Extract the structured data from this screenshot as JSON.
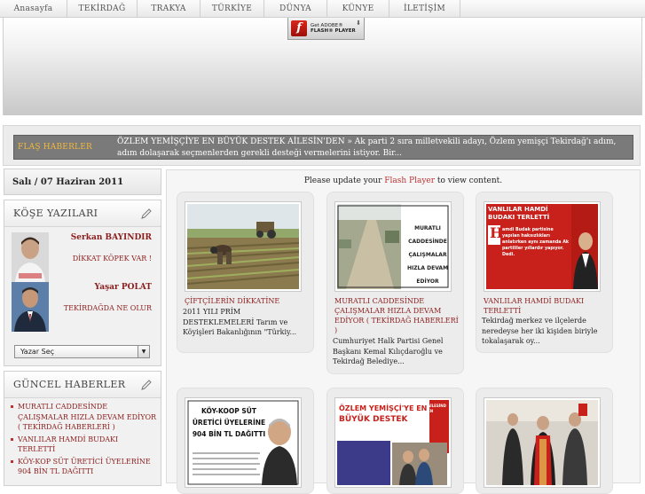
{
  "nav": {
    "items": [
      "Anasayfa",
      "TEKİRDAĞ",
      "TRAKYA",
      "TÜRKİYE",
      "DÜNYA",
      "KÜNYE",
      "İLETİŞİM"
    ]
  },
  "banner": {
    "flash_badge": {
      "line1": "Get ADOBE®",
      "line2": "FLASH® PLAYER",
      "logo_letter": "f",
      "download_glyph": "⬇"
    }
  },
  "flash_news": {
    "label": "FLAŞ HABERLER",
    "text": "ÖZLEM YEMİŞÇİYE EN BÜYÜK DESTEK AİLESİN'DEN »   Ak parti 2 sıra milletvekili adayı, Özlem yemişçi Tekirdağ'ı adım, adım dolaşarak seçmenlerden gerekli desteği vermelerini istiyor. Bir..."
  },
  "date": "Salı / 07 Haziran 2011",
  "columnists": {
    "title": "KÖŞE YAZILARI",
    "icon": "pencil-icon",
    "authors": [
      {
        "name": "Serkan BAYINDIR",
        "article": "DİKKAT KÖPEK VAR !"
      },
      {
        "name": "Yaşar POLAT",
        "article": "TEKİRDAĞDA NE OLUR"
      }
    ],
    "select_label": "Yazar Seç"
  },
  "current_news": {
    "title": "GÜNCEL HABERLER",
    "icon": "pencil-icon",
    "items": [
      "MURATLI CADDESİNDE ÇALIŞMALAR HIZLA DEVAM EDİYOR ( TEKİRDAĞ HABERLERİ )",
      "VANLILAR HAMDİ BUDAKI TERLETTİ",
      "KÖY-KOP SÜT ÜRETİCİ ÜYELERİNE 904 BİN TL DAĞITTI"
    ]
  },
  "main": {
    "notice_before": "Please update your",
    "notice_link": "Flash Player",
    "notice_after": "to view content.",
    "cards": [
      {
        "title": "ÇİFTÇİLERİN DİKKATİNE",
        "desc": "2011 YILI PRİM DESTEKLEMELERİ Tarım ve Köyişleri Bakanlığının \"Türkiy..."
      },
      {
        "title": "MURATLI CADDESİNDE ÇALIŞMALAR HIZLA DEVAM EDİYOR ( TEKİRDAĞ HABERLERİ )",
        "desc": "Cumhuriyet Halk Partisi Genel Başkanı Kemal Kılıçdaroğlu ve Tekirdağ Belediye...",
        "image_text": [
          "MURATLI CADDESİNDE",
          "ÇALIŞMALAR",
          "HIZLA DEVAM EDİYOR"
        ]
      },
      {
        "title": "VANLILAR HAMDİ BUDAKI TERLETTİ",
        "desc": "Tekirdağ merkez ve ilçelerde neredeyse her iki kişiden biriyle tokalaşarak oy...",
        "image_text": [
          "VANLILAR HAMDİ BUDAKI TERLETTİ",
          "H",
          "amdi Budak partisine yapılan haksızlıkları anlatırken aynı zamanda Ak partililer yıllardır yapıyor. Dedi."
        ]
      },
      {
        "title": "",
        "desc": "",
        "image_text": [
          "KÖY-KOOP SÜT",
          "ÜRETİCİ ÜYELERİNE",
          "904 BİN TL DAĞITTI"
        ]
      },
      {
        "title": "",
        "desc": "",
        "image_text": [
          "ÖZLEM YEMİŞÇİ'YE EN",
          "BÜYÜK DESTEK",
          "AİLESİNDEN"
        ]
      },
      {
        "title": "",
        "desc": ""
      }
    ]
  },
  "colors": {
    "accent_red": "#8b1c1c",
    "flash_label": "#f2b83a",
    "flash_bar": "#7a7a7a"
  }
}
